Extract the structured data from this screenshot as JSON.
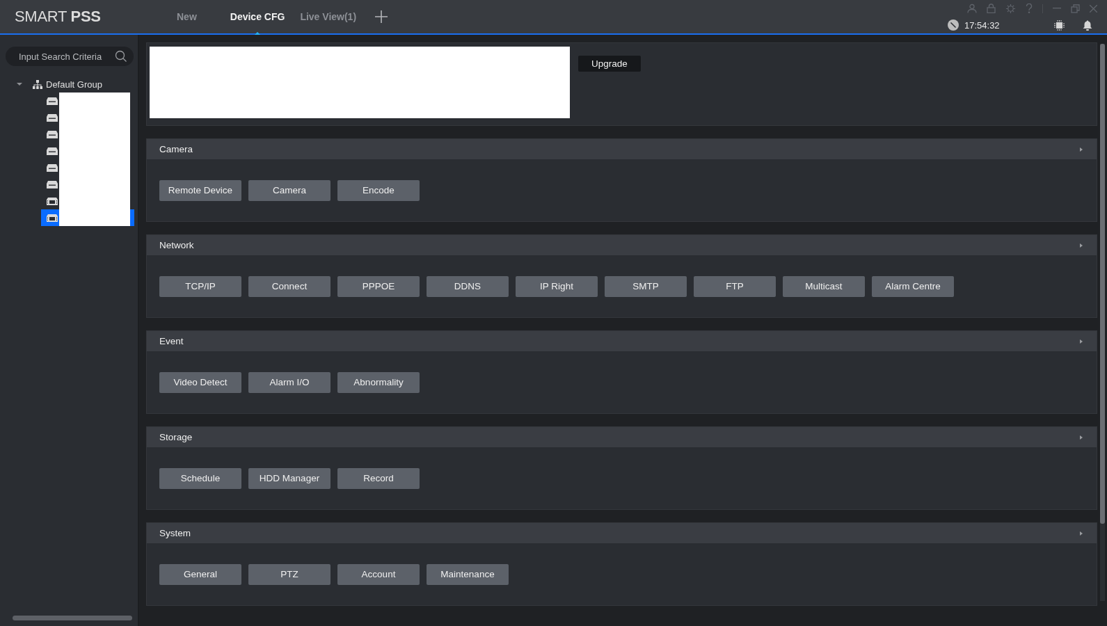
{
  "app": {
    "logo_light": "SMART",
    "logo_bold": "PSS"
  },
  "tabs": [
    {
      "label": "New",
      "selected": false
    },
    {
      "label": "Device CFG",
      "selected": true
    },
    {
      "label": "Live View(1)",
      "selected": false
    }
  ],
  "status": {
    "time": "17:54:32"
  },
  "sidebar": {
    "search": {
      "placeholder": "Input Search Criteria"
    },
    "tree": [
      {
        "label": "Default Group",
        "expanded": true,
        "children": [
          {
            "kind": "recorder",
            "selected": false
          },
          {
            "kind": "recorder",
            "selected": false
          },
          {
            "kind": "recorder",
            "selected": false
          },
          {
            "kind": "recorder",
            "selected": false
          },
          {
            "kind": "recorder",
            "selected": false
          },
          {
            "kind": "recorder",
            "selected": false
          },
          {
            "kind": "camera",
            "selected": false
          },
          {
            "kind": "camera",
            "selected": true
          }
        ]
      }
    ]
  },
  "device": {
    "upgrade_button": "Upgrade"
  },
  "sections": [
    {
      "title": "Camera",
      "buttons": [
        "Remote Device",
        "Camera",
        "Encode"
      ]
    },
    {
      "title": "Network",
      "buttons": [
        "TCP/IP",
        "Connect",
        "PPPOE",
        "DDNS",
        "IP Right",
        "SMTP",
        "FTP",
        "Multicast",
        "Alarm Centre"
      ]
    },
    {
      "title": "Event",
      "buttons": [
        "Video Detect",
        "Alarm I/O",
        "Abnormality"
      ]
    },
    {
      "title": "Storage",
      "buttons": [
        "Schedule",
        "HDD Manager",
        "Record"
      ]
    },
    {
      "title": "System",
      "buttons": [
        "General",
        "PTZ",
        "Account",
        "Maintenance"
      ]
    }
  ]
}
